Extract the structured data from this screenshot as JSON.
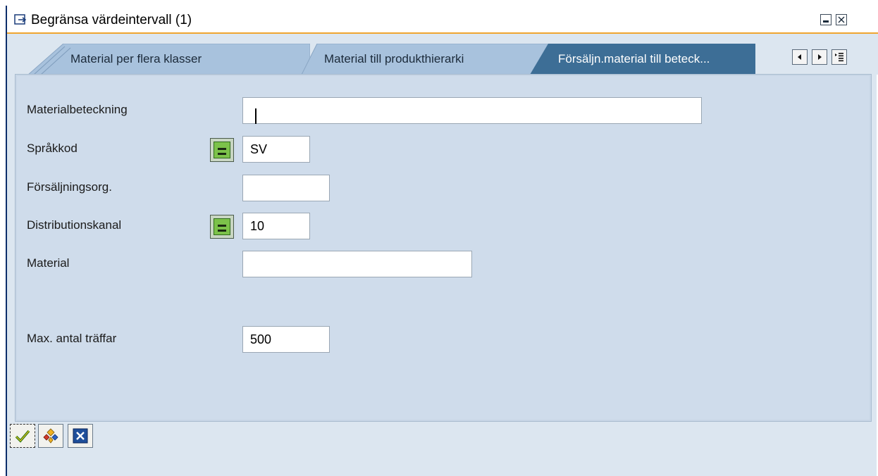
{
  "window": {
    "title": "Begränsa värdeintervall (1)",
    "icons": {
      "title": "dialog-icon",
      "minimize": "minimize-icon",
      "close": "close-icon"
    }
  },
  "tabs": [
    {
      "label": "Material per flera klasser",
      "active": false
    },
    {
      "label": "Material till produkthierarki",
      "active": false
    },
    {
      "label": "Försäljn.material till beteck...",
      "active": true
    }
  ],
  "tab_nav": {
    "prev_icon": "arrow-left-icon",
    "next_icon": "arrow-right-icon",
    "list_icon": "tab-list-icon"
  },
  "form": {
    "materialbeteckning": {
      "label": "Materialbeteckning",
      "value": ""
    },
    "sprakkod": {
      "label": "Språkkod",
      "value": "SV",
      "operator_icon": "equals-operator-icon"
    },
    "forsaljningsorg": {
      "label": "Försäljningsorg.",
      "value": ""
    },
    "distributionskanal": {
      "label": "Distributionskanal",
      "value": "10",
      "operator_icon": "equals-operator-icon"
    },
    "material": {
      "label": "Material",
      "value": ""
    },
    "max_antal": {
      "label": "Max. antal träffar",
      "value": "500"
    }
  },
  "footer": {
    "confirm_icon": "checkmark-icon",
    "multiple_icon": "multiple-selection-icon",
    "cancel_icon": "cancel-icon"
  },
  "colors": {
    "accent_orange": "#f0a530",
    "active_tab": "#3d6e96",
    "inactive_tab": "#a8c2dd",
    "background": "#cfdceb",
    "window_border": "#0c2d6a"
  }
}
